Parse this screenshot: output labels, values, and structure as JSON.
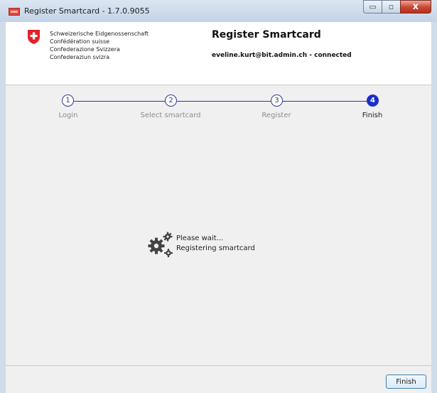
{
  "window": {
    "title": "Register Smartcard - 1.7.0.9055",
    "controls": {
      "minimize": "▭",
      "maximize": "▫",
      "close": "x"
    }
  },
  "header": {
    "confederation_lines": [
      "Schweizerische Eidgenossenschaft",
      "Confédération suisse",
      "Confederazione Svizzera",
      "Confederaziun svizra"
    ],
    "title": "Register Smartcard",
    "user_status": "eveline.kurt@bit.admin.ch - connected"
  },
  "steps": [
    {
      "number": "1",
      "label": "Login",
      "active": false
    },
    {
      "number": "2",
      "label": "Select smartcard",
      "active": false
    },
    {
      "number": "3",
      "label": "Register",
      "active": false
    },
    {
      "number": "4",
      "label": "Finish",
      "active": true
    }
  ],
  "progress": {
    "line1": "Please wait...",
    "line2": "Registering smartcard",
    "icon": "gears-icon"
  },
  "footer": {
    "finish_label": "Finish"
  },
  "colors": {
    "step_accent": "#2a3d8f",
    "step_active": "#1a2fc9",
    "swiss_red": "#e41f26"
  }
}
